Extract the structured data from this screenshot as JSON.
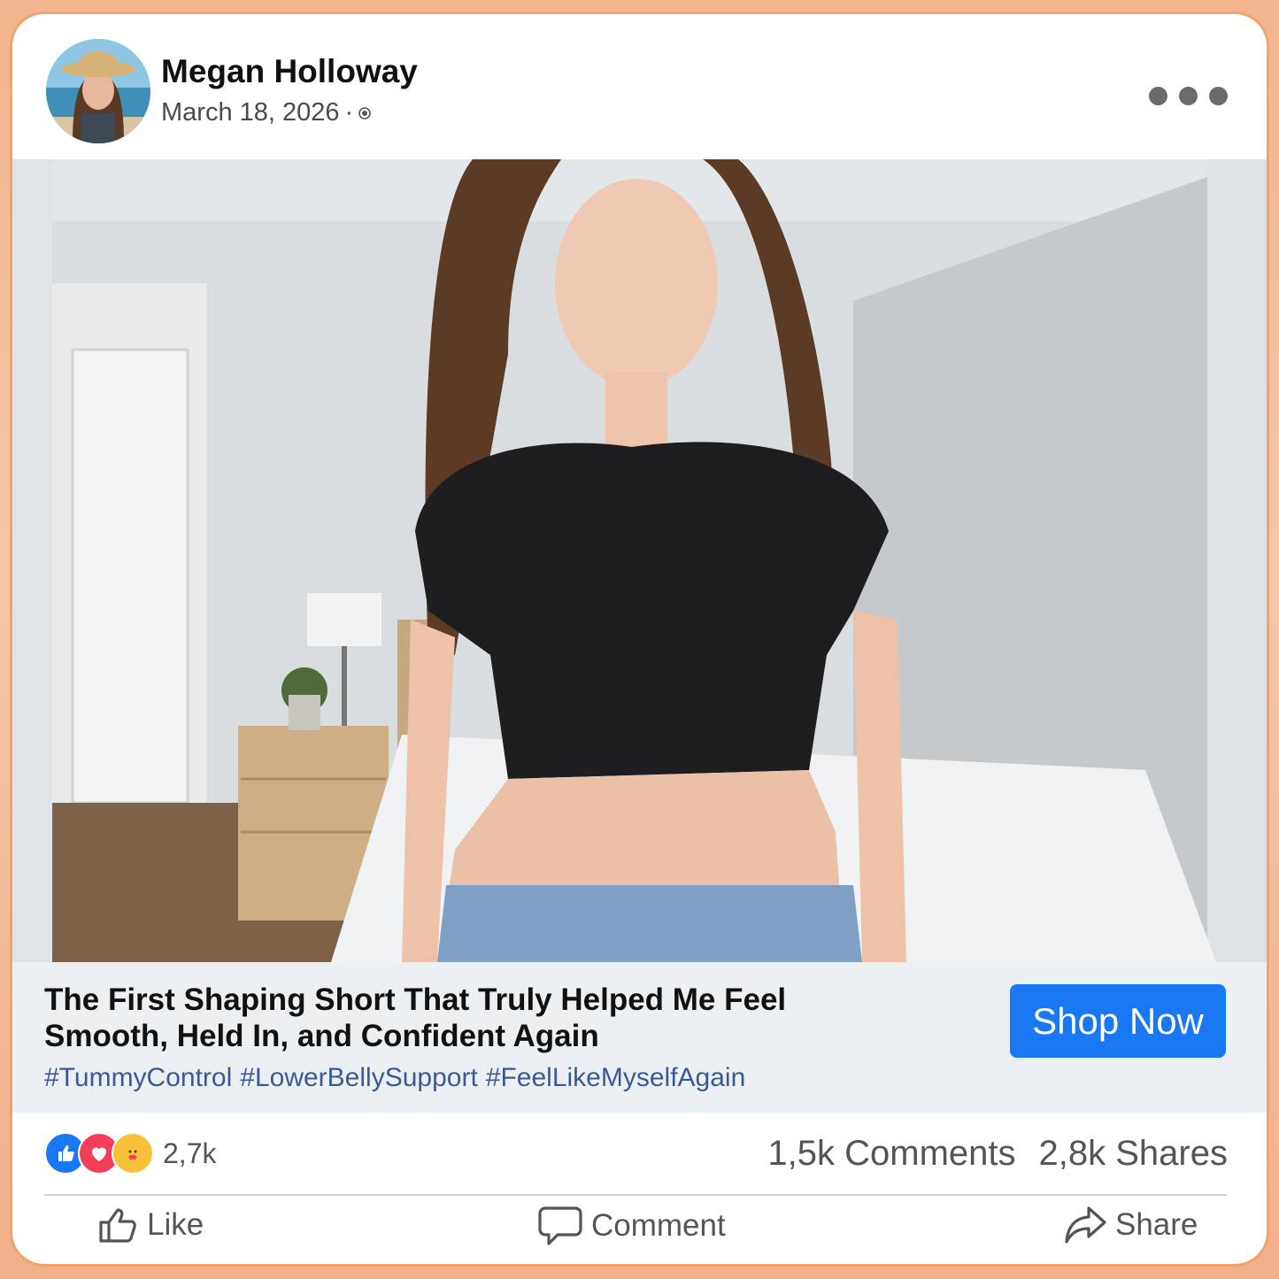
{
  "post": {
    "author": "Megan Holloway",
    "date": "March 18, 2026",
    "date_separator": "·"
  },
  "ad": {
    "headline": "The First Shaping Short That Truly Helped Me Feel Smooth, Held In, and Confident Again",
    "hashtags": [
      "#TummyControl",
      "#LowerBellySupport",
      "#FeelLikeMyselfAgain"
    ],
    "cta_label": "Shop Now",
    "cta_color": "#1877f2"
  },
  "stats": {
    "reactions": [
      "like-icon",
      "love-icon",
      "care-icon"
    ],
    "reaction_count": "2,7k",
    "comments": "1,5k Comments",
    "shares": "2,8k Shares"
  },
  "actions": {
    "like_label": "Like",
    "comment_label": "Comment",
    "share_label": "Share"
  }
}
